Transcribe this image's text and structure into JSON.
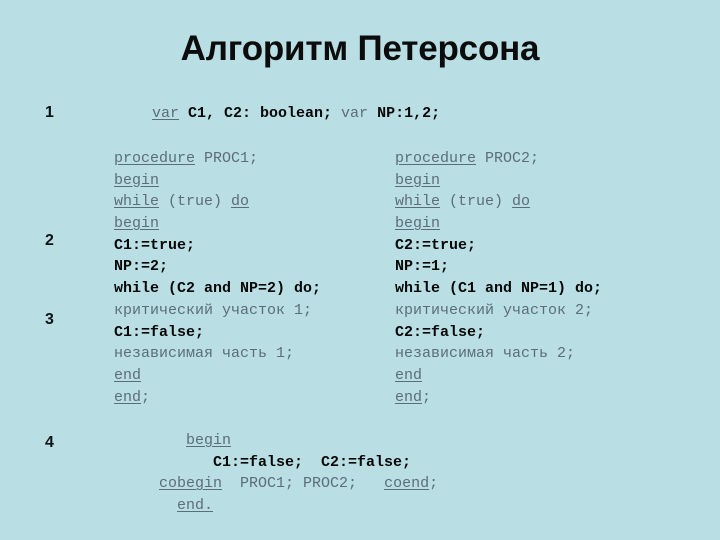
{
  "slide": {
    "title": "Алгоритм Петерсона",
    "background_color": "#b9dfe4",
    "keyword_color": "#5d6d76",
    "identifier_color": "#070707",
    "marker_color": "#0d1417"
  },
  "markers": {
    "m1": "1",
    "m2": "2",
    "m3": "3",
    "m4": "4"
  },
  "declaration": {
    "kw_var": "var",
    "vars": " C1, C2: boolean;",
    "pl_var": " var ",
    "np": "NP:1,2;"
  },
  "proc_left": {
    "l1_kw": "procedure",
    "l1_name": " PROC1;",
    "l2_kw": "begin",
    "l3_kw_while": "while",
    "l3_cond": " (true) ",
    "l3_kw_do": "do",
    "l4_kw": "begin",
    "l5": "C1:=true;",
    "l6": "NP:=2;",
    "l7": "while (C2 and NP=2) do;",
    "l8": "критический участок 1;",
    "l9": "C1:=false;",
    "l10": "независимая часть 1;",
    "l11_kw": "end",
    "l12_kw": "end",
    "l12_semi": ";"
  },
  "proc_right": {
    "l1_kw": "procedure",
    "l1_name": " PROC2;",
    "l2_kw": "begin",
    "l3_kw_while": "while",
    "l3_cond": " (true) ",
    "l3_kw_do": "do",
    "l4_kw": "begin",
    "l5": "C2:=true;",
    "l6": "NP:=1;",
    "l7": "while (C1 and NP=1) do;",
    "l8": "критический участок 2;",
    "l9": "C2:=false;",
    "l10": "независимая часть 2;",
    "l11_kw": "end",
    "l12_kw": "end",
    "l12_semi": ";"
  },
  "main_block": {
    "l1_indent": "        ",
    "l1_kw": "begin",
    "l2": "           C1:=false;  C2:=false;",
    "l3_indent": "     ",
    "l3_kw_cobegin": "cobegin",
    "l3_procs": "  PROC1; PROC2;   ",
    "l3_kw_coend": "coend",
    "l3_semi": ";",
    "l4_indent": "       ",
    "l4_kw": "end."
  }
}
